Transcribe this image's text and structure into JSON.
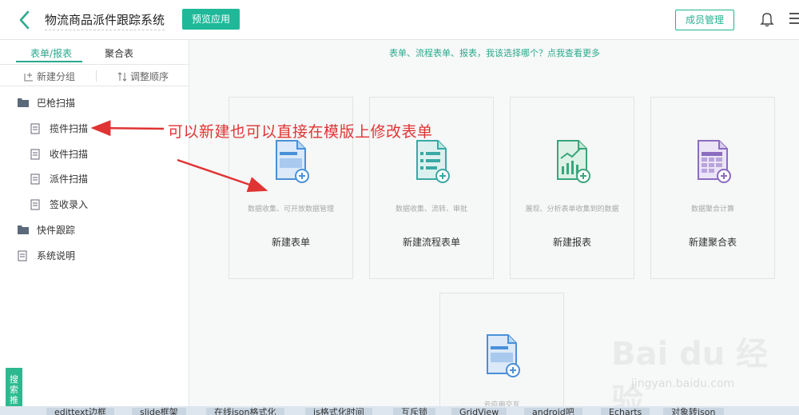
{
  "header": {
    "app_title": "物流商品派件跟踪系统",
    "preview_label": "预览应用",
    "member_label": "成员管理"
  },
  "sidebar": {
    "tabs": [
      {
        "label": "表单/报表",
        "active": true
      },
      {
        "label": "聚合表",
        "active": false
      }
    ],
    "tools": [
      {
        "label": "新建分组",
        "icon": "add-group-icon"
      },
      {
        "label": "调整顺序",
        "icon": "sort-icon"
      }
    ],
    "tree": [
      {
        "label": "巴枪扫描",
        "type": "folder",
        "level": 0
      },
      {
        "label": "揽件扫描",
        "type": "form",
        "level": 1
      },
      {
        "label": "收件扫描",
        "type": "form",
        "level": 1
      },
      {
        "label": "派件扫描",
        "type": "form",
        "level": 1
      },
      {
        "label": "签收录入",
        "type": "form",
        "level": 1
      },
      {
        "label": "快件跟踪",
        "type": "folder",
        "level": 0
      },
      {
        "label": "系统说明",
        "type": "form",
        "level": 0
      }
    ]
  },
  "main": {
    "help_link": "表单、流程表单、报表，我该选择哪个？点我查看更多",
    "cards": [
      {
        "desc": "数据收集、可开放数据管理",
        "label": "新建表单",
        "icon": "form-icon"
      },
      {
        "desc": "数据收集、流转、审批",
        "label": "新建流程表单",
        "icon": "flow-form-icon"
      },
      {
        "desc": "展现、分析表单收集到的数据",
        "label": "新建报表",
        "icon": "report-icon"
      },
      {
        "desc": "数据聚合计算",
        "label": "新建聚合表",
        "icon": "aggregate-icon"
      },
      {
        "desc": "云应用交互",
        "label": "",
        "icon": "cloud-app-icon"
      }
    ]
  },
  "annotation": {
    "text": "可以新建也可以直接在模版上修改表单"
  },
  "watermark": {
    "brand": "Bai  du 经验",
    "url": "jingyan.baidu.com"
  },
  "bottom": {
    "side_widget": "搜索推",
    "chips": [
      "edittext边框",
      "slide框架",
      "在线json格式化",
      "js格式化时间",
      "互斥锁",
      "GridView",
      "android吧",
      "Echarts",
      "对象转json"
    ]
  },
  "colors": {
    "accent": "#2aa98c",
    "primary_button": "#1fb99a",
    "annotation": "#e03434",
    "report_icon": "#3aa57c",
    "aggregate_icon": "#8b6cc1",
    "form_icon": "#4a90d9"
  }
}
